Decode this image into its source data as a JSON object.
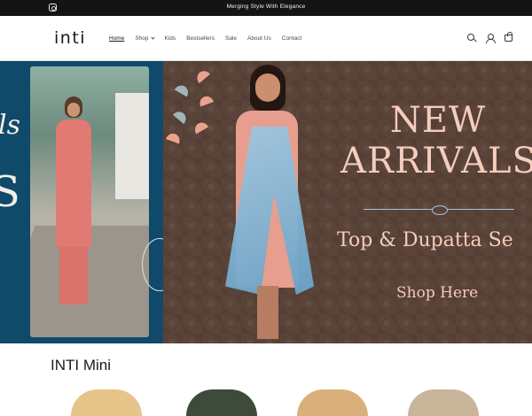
{
  "announcement": {
    "text": "Merging Style With Elegance",
    "social_icon": "instagram-icon"
  },
  "header": {
    "logo": "inti",
    "nav": [
      {
        "label": "Home",
        "active": true
      },
      {
        "label": "Shop",
        "has_dropdown": true
      },
      {
        "label": "Kids"
      },
      {
        "label": "Bestsellers"
      },
      {
        "label": "Sale"
      },
      {
        "label": "About Us"
      },
      {
        "label": "Contact"
      }
    ],
    "icons": [
      "search-icon",
      "account-icon",
      "cart-icon"
    ]
  },
  "hero": {
    "headline_1": "NEW",
    "headline_2": "ARRIVALS",
    "subline": "Top & Dupatta Se",
    "cta": "Shop Here",
    "left_script": "ls",
    "left_letter": "S",
    "colors": {
      "left_panel": "#0f4a6b",
      "right_panel": "#5a4338",
      "text": "#f4cdbc",
      "ornament": "#9fc7dc"
    }
  },
  "collection": {
    "title": "INTI Mini"
  }
}
